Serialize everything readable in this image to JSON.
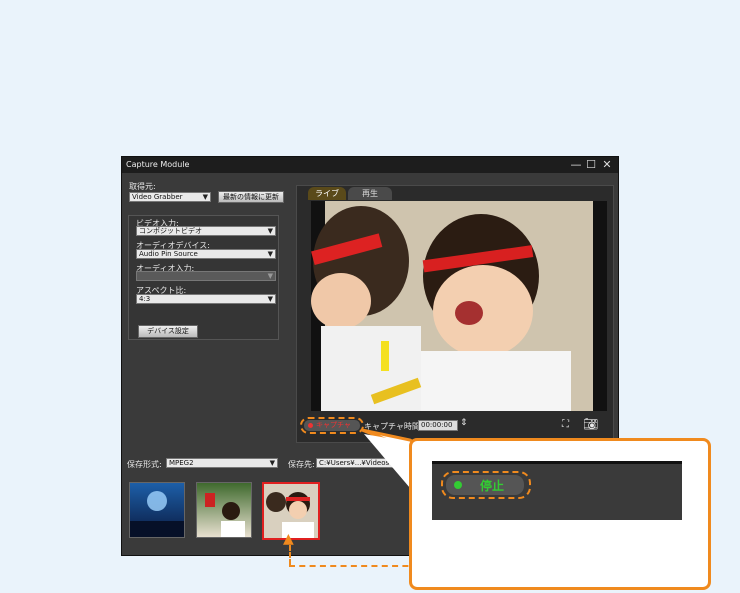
{
  "window": {
    "title": "Capture Module",
    "controls": [
      "—",
      "☐",
      "✕"
    ]
  },
  "source": {
    "label": "取得元:",
    "value": "Video Grabber",
    "refresh_button": "最新の情報に更新"
  },
  "device": {
    "video_input_label": "ビデオ入力:",
    "video_input_value": "コンポジットビデオ",
    "audio_device_label": "オーディオデバイス:",
    "audio_device_value": "Audio Pin Source",
    "audio_input_label": "オーディオ入力:",
    "audio_input_value": "",
    "aspect_label": "アスペクト比:",
    "aspect_value": "4:3",
    "settings_button": "デバイス設定"
  },
  "tabs": [
    {
      "label": "ライブ",
      "active": true
    },
    {
      "label": "再生",
      "active": false
    }
  ],
  "controls": {
    "capture_button": "キャプチャ",
    "capture_time_label": "キャプチャ時間",
    "capture_time_value": "00:00:00"
  },
  "save": {
    "format_label": "保存形式:",
    "format_value": "MPEG2",
    "dest_label": "保存先:",
    "dest_value": "C:¥Users¥...¥Videos"
  },
  "callout": {
    "stop_label": "停止"
  },
  "colors": {
    "accent": "#f08a1e",
    "record_red": "#e33",
    "stop_green": "#3c3",
    "thumb_selected_border": "#e02020"
  },
  "icons": [
    "fit-screen-icon",
    "camera-icon",
    "record-dot-icon",
    "spinner-icon",
    "arrow-up-icon"
  ]
}
